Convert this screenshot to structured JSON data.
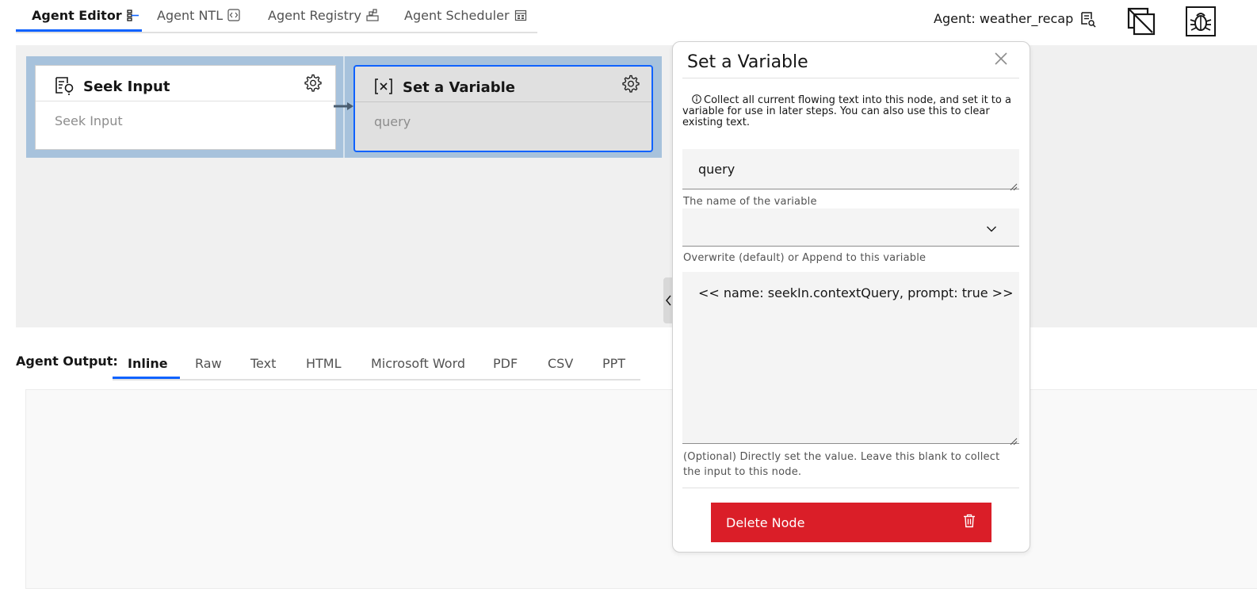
{
  "header": {
    "tabs": [
      {
        "label": "Agent Editor",
        "icon": "flow-icon",
        "active": true
      },
      {
        "label": "Agent NTL",
        "icon": "code-icon",
        "active": false
      },
      {
        "label": "Agent Registry",
        "icon": "registry-icon",
        "active": false
      },
      {
        "label": "Agent Scheduler",
        "icon": "calendar-icon",
        "active": false
      }
    ],
    "agent_label": "Agent: weather_recap",
    "icons": [
      "document-search-icon",
      "deploy-icon",
      "debug-icon"
    ]
  },
  "canvas": {
    "nodes": [
      {
        "title": "Seek Input",
        "subtitle": "Seek Input",
        "icon": "seek-input-icon"
      },
      {
        "title": "Set a Variable",
        "subtitle": "query",
        "icon": "variable-icon"
      }
    ]
  },
  "output": {
    "label": "Agent Output:",
    "tabs": [
      "Inline",
      "Raw",
      "Text",
      "HTML",
      "Microsoft Word",
      "PDF",
      "CSV",
      "PPT"
    ],
    "active_tab": "Inline"
  },
  "panel": {
    "title": "Set a Variable",
    "description": "Collect all current flowing text into this node, and set it to a variable for use in later steps. You can also use this to clear existing text.",
    "variable_name_value": "query",
    "variable_name_label": "The name of the variable",
    "mode_value": "",
    "mode_label": "Overwrite (default) or Append to this variable",
    "value_text": "<< name: seekIn.contextQuery, prompt: true >>",
    "value_label": "(Optional) Directly set the value. Leave this blank to collect the input to this node.",
    "delete_label": "Delete Node"
  },
  "colors": {
    "accent": "#0f62fe",
    "danger": "#da1e28",
    "flow_background": "#a7c2dc"
  }
}
